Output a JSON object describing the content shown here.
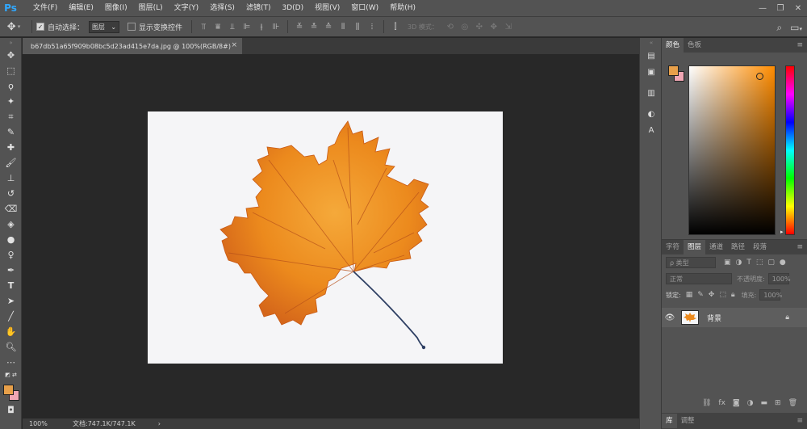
{
  "app": {
    "logo": "Ps"
  },
  "menu": [
    "文件(F)",
    "编辑(E)",
    "图像(I)",
    "图层(L)",
    "文字(Y)",
    "选择(S)",
    "滤镜(T)",
    "3D(D)",
    "视图(V)",
    "窗口(W)",
    "帮助(H)"
  ],
  "window_controls": {
    "minimize": "—",
    "restore": "❐",
    "close": "✕"
  },
  "options": {
    "auto_select_label": "自动选择：",
    "auto_select_checked": true,
    "auto_select_target": "图层",
    "show_transform_label": "显示变换控件",
    "show_transform_checked": false,
    "mode_3d_label": "3D 模式："
  },
  "document": {
    "tab_title": "b67db51a65f909b08bc5d23ad415e7da.jpg @ 100%(RGB/8#)",
    "close": "×"
  },
  "status": {
    "zoom": "100%",
    "doc_info": "文档:747.1K/747.1K",
    "arrow": "›"
  },
  "swatches": {
    "foreground": "#e8a04a",
    "background": "#f0a6b4"
  },
  "color_panel": {
    "tabs": [
      "颜色",
      "色板"
    ],
    "active_tab": 0
  },
  "layers_panel": {
    "tabs": [
      "字符",
      "图层",
      "通道",
      "路径",
      "段落"
    ],
    "active_tab": 1,
    "filter_kind": "ρ 类型",
    "blend_mode": "正常",
    "opacity_label": "不透明度:",
    "opacity_value": "100%",
    "lock_label": "锁定:",
    "fill_label": "填充:",
    "fill_value": "100%",
    "layers": [
      {
        "name": "背景",
        "visible": true,
        "locked": true
      }
    ]
  },
  "bottom_tabs": [
    "库",
    "调整"
  ]
}
